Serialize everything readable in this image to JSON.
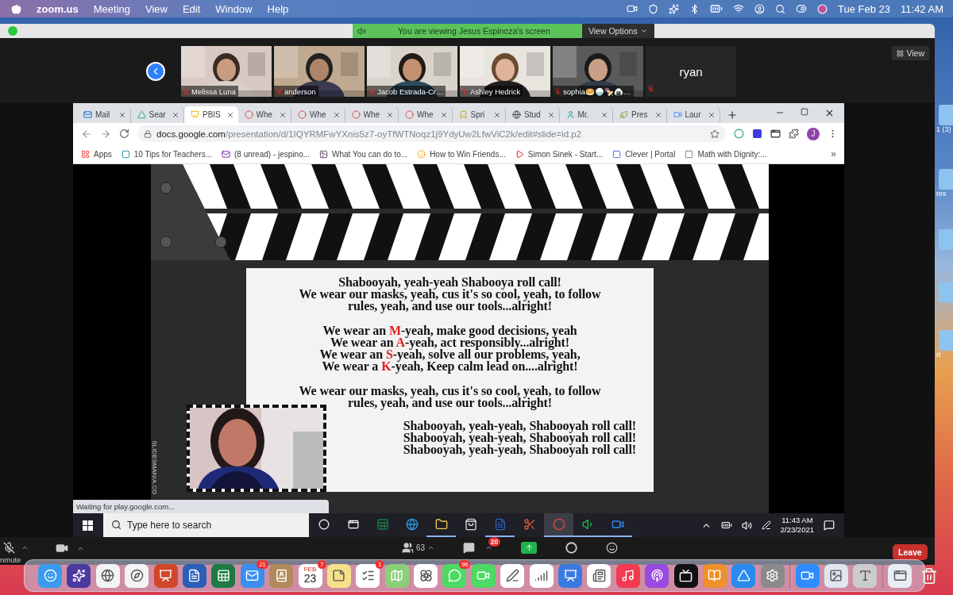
{
  "menu_bar": {
    "app": "zoom.us",
    "items": [
      "Meeting",
      "View",
      "Edit",
      "Window",
      "Help"
    ],
    "date": "Tue Feb 23",
    "time": "11:42 AM"
  },
  "desktop_labels": [
    "1 (3)",
    "res",
    "rt"
  ],
  "zoom": {
    "banner": "You are viewing Jesus Espinoza's screen",
    "view_options": "View Options",
    "view_button": "View",
    "participants": [
      {
        "name": "Melissa Luna",
        "kind": "video",
        "muted": true
      },
      {
        "name": "anderson",
        "kind": "video",
        "muted": true
      },
      {
        "name": "Jacob Estrada-Cr…",
        "kind": "video",
        "muted": true
      },
      {
        "name": "Ashley Hedrick",
        "kind": "video",
        "muted": true
      },
      {
        "name": "sophia🥯🍚🍢🍙…",
        "kind": "video",
        "muted": true
      },
      {
        "name": "ryan",
        "kind": "avatar",
        "muted": true
      }
    ],
    "toolbar": {
      "mic_label": "nmute",
      "muted": true,
      "participants_count": "63",
      "chat_badge": "20",
      "leave": "Leave"
    }
  },
  "browser": {
    "tabs": [
      {
        "label": "Mail",
        "selected": false
      },
      {
        "label": "Sear",
        "selected": false
      },
      {
        "label": "PBIS",
        "selected": true
      },
      {
        "label": "Whe",
        "selected": false
      },
      {
        "label": "Whe",
        "selected": false
      },
      {
        "label": "Whe",
        "selected": false
      },
      {
        "label": "Whe",
        "selected": false
      },
      {
        "label": "Spri",
        "selected": false
      },
      {
        "label": "Stud",
        "selected": false
      },
      {
        "label": "Mr.",
        "selected": false
      },
      {
        "label": "Pres",
        "selected": false
      },
      {
        "label": "Laur",
        "selected": false
      }
    ],
    "url_host": "docs.google.com",
    "url_path": "/presentation/d/1IQYRMFwYXnis5z7-oyTfWTNoqz1j9YdyUw2LfwViC2k/edit#slide=id.p2",
    "avatar": "J",
    "bookmarks": [
      "Apps",
      "10 Tips for Teachers...",
      "(8 unread) - jespino...",
      "What You can do to...",
      "How to Win Friends...",
      "Simon Sinek - Start...",
      "Clever | Portal",
      "Math with Dignity:..."
    ],
    "more_bookmarks": "»",
    "status": "Waiting for play.google.com..."
  },
  "slide": {
    "watermark": "SLIDESMANIA.CO",
    "stanzas": [
      {
        "kind": "verse",
        "lines": [
          "Shabooyah, yeah-yeah Shabooya roll call!",
          "We wear our masks, yeah, cus it's so cool, yeah, to follow",
          "rules, yeah, and use our tools...alright!"
        ]
      },
      {
        "kind": "verse",
        "lines": [
          {
            "before": "We wear an ",
            "key": "M",
            "after": "-yeah, make good decisions, yeah"
          },
          {
            "before": "We wear an ",
            "key": "A",
            "after": "-yeah, act responsibly...alright!"
          },
          {
            "before": "We wear an ",
            "key": "S",
            "after": "-yeah, solve all our problems, yeah,"
          },
          {
            "before": "We wear a ",
            "key": "K",
            "after": "-yeah, Keep calm lead on....alright!"
          }
        ]
      },
      {
        "kind": "verse",
        "lines": [
          "We wear our masks, yeah, cus it's so cool, yeah, to follow",
          "rules, yeah, and use our tools...alright!"
        ]
      },
      {
        "kind": "chorus",
        "lines": [
          "Shabooyah, yeah-yeah, Shabooyah roll call!",
          "Shabooyah, yeah-yeah, Shabooyah roll call!",
          "Shabooyah, yeah-yeah, Shabooyah roll call!"
        ]
      }
    ]
  },
  "taskbar": {
    "search_placeholder": "Type here to search",
    "time": "11:43 AM",
    "date": "2/23/2021",
    "apps": [
      {
        "running": false,
        "active": false
      },
      {
        "running": false,
        "active": false
      },
      {
        "running": true,
        "active": false
      },
      {
        "running": false,
        "active": false
      },
      {
        "running": true,
        "active": false
      },
      {
        "running": false,
        "active": false
      },
      {
        "running": true,
        "active": true
      },
      {
        "running": true,
        "active": false
      },
      {
        "running": true,
        "active": false
      }
    ]
  },
  "dock": {
    "mail_badge": "21",
    "calendar_month": "FEB",
    "calendar_day": "23",
    "calendar_badge": "7",
    "reminders_badge": "1",
    "messages_badge": "96"
  }
}
